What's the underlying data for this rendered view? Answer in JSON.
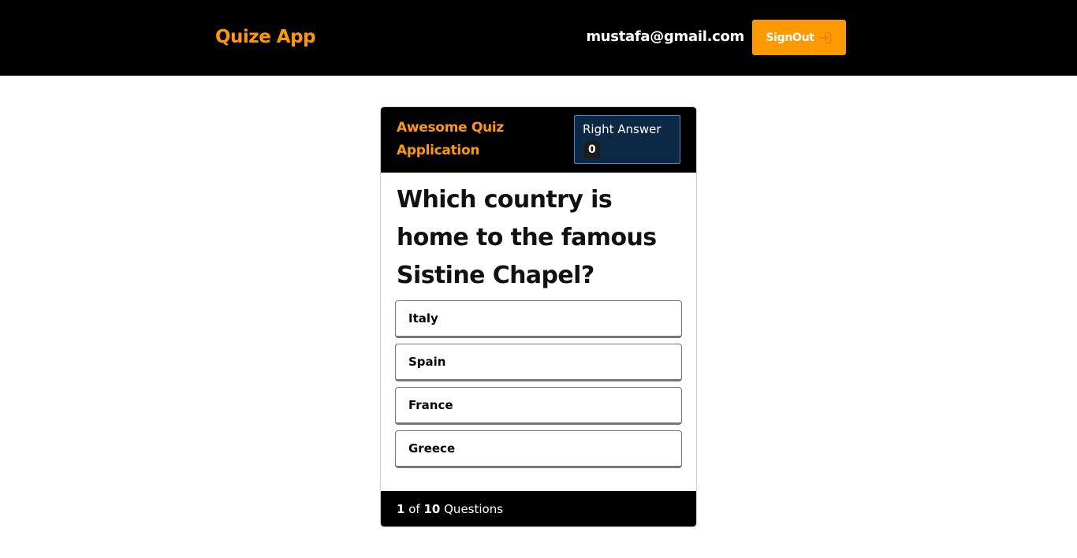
{
  "navbar": {
    "brand": "Quize App",
    "user_email": "mustafa@gmail.com",
    "signout_label": "SignOut",
    "signout_icon": "sign-in-arrow-icon"
  },
  "colors": {
    "accent": "#ff9900",
    "header_bg": "#000000",
    "score_bg": "#0b2845",
    "score_border": "#3d8bd8"
  },
  "quiz": {
    "title": "Awesome Quiz Application",
    "score_label": "Right Answer",
    "score_value": "0",
    "question": "Which country is home to the famous Sistine Chapel?",
    "options": [
      "Italy",
      "Spain",
      "France",
      "Greece"
    ],
    "progress": {
      "current": "1",
      "of_word": "of",
      "total": "10",
      "suffix": "Questions"
    }
  }
}
